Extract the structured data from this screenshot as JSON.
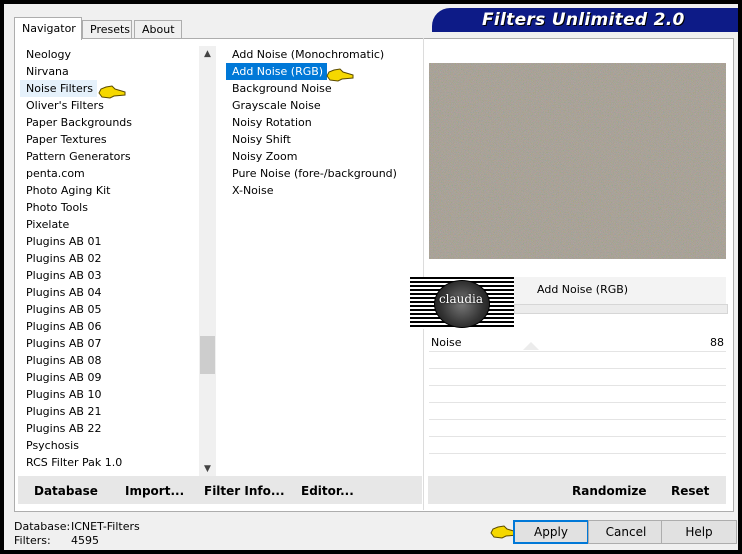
{
  "window": {
    "title": "Filters Unlimited 2.0",
    "tabs": [
      "Navigator",
      "Presets",
      "About"
    ],
    "active_tab": "Navigator"
  },
  "categories": {
    "items": [
      "Neology",
      "Nirvana",
      "Noise Filters",
      "Oliver's Filters",
      "Paper Backgrounds",
      "Paper Textures",
      "Pattern Generators",
      "penta.com",
      "Photo Aging Kit",
      "Photo Tools",
      "Pixelate",
      "Plugins AB 01",
      "Plugins AB 02",
      "Plugins AB 03",
      "Plugins AB 04",
      "Plugins AB 05",
      "Plugins AB 06",
      "Plugins AB 07",
      "Plugins AB 08",
      "Plugins AB 09",
      "Plugins AB 10",
      "Plugins AB 21",
      "Plugins AB 22",
      "Psychosis",
      "RCS Filter Pak 1.0"
    ],
    "highlighted": "Noise Filters"
  },
  "filters": {
    "items": [
      "Add Noise (Monochromatic)",
      "Add Noise (RGB)",
      "Background Noise",
      "Grayscale Noise",
      "Noisy Rotation",
      "Noisy Shift",
      "Noisy Zoom",
      "Pure Noise (fore-/background)",
      "X-Noise"
    ],
    "selected": "Add Noise (RGB)"
  },
  "preview": {
    "filter_name": "Add Noise (RGB)",
    "logo_text": "claudia",
    "params": [
      {
        "label": "Noise",
        "value": "88"
      }
    ]
  },
  "left_buttons": {
    "database": "Database",
    "import": "Import...",
    "filter_info": "Filter Info...",
    "editor": "Editor..."
  },
  "right_buttons": {
    "randomize": "Randomize",
    "reset": "Reset"
  },
  "status": {
    "database_label": "Database:",
    "database_value": "ICNET-Filters",
    "filters_label": "Filters:",
    "filters_value": "4595"
  },
  "dialog_buttons": {
    "apply": "Apply",
    "cancel": "Cancel",
    "help": "Help"
  },
  "colors": {
    "banner": "#0d1b87",
    "selection": "#0078d7",
    "pointer_hand": "#f5d800"
  }
}
